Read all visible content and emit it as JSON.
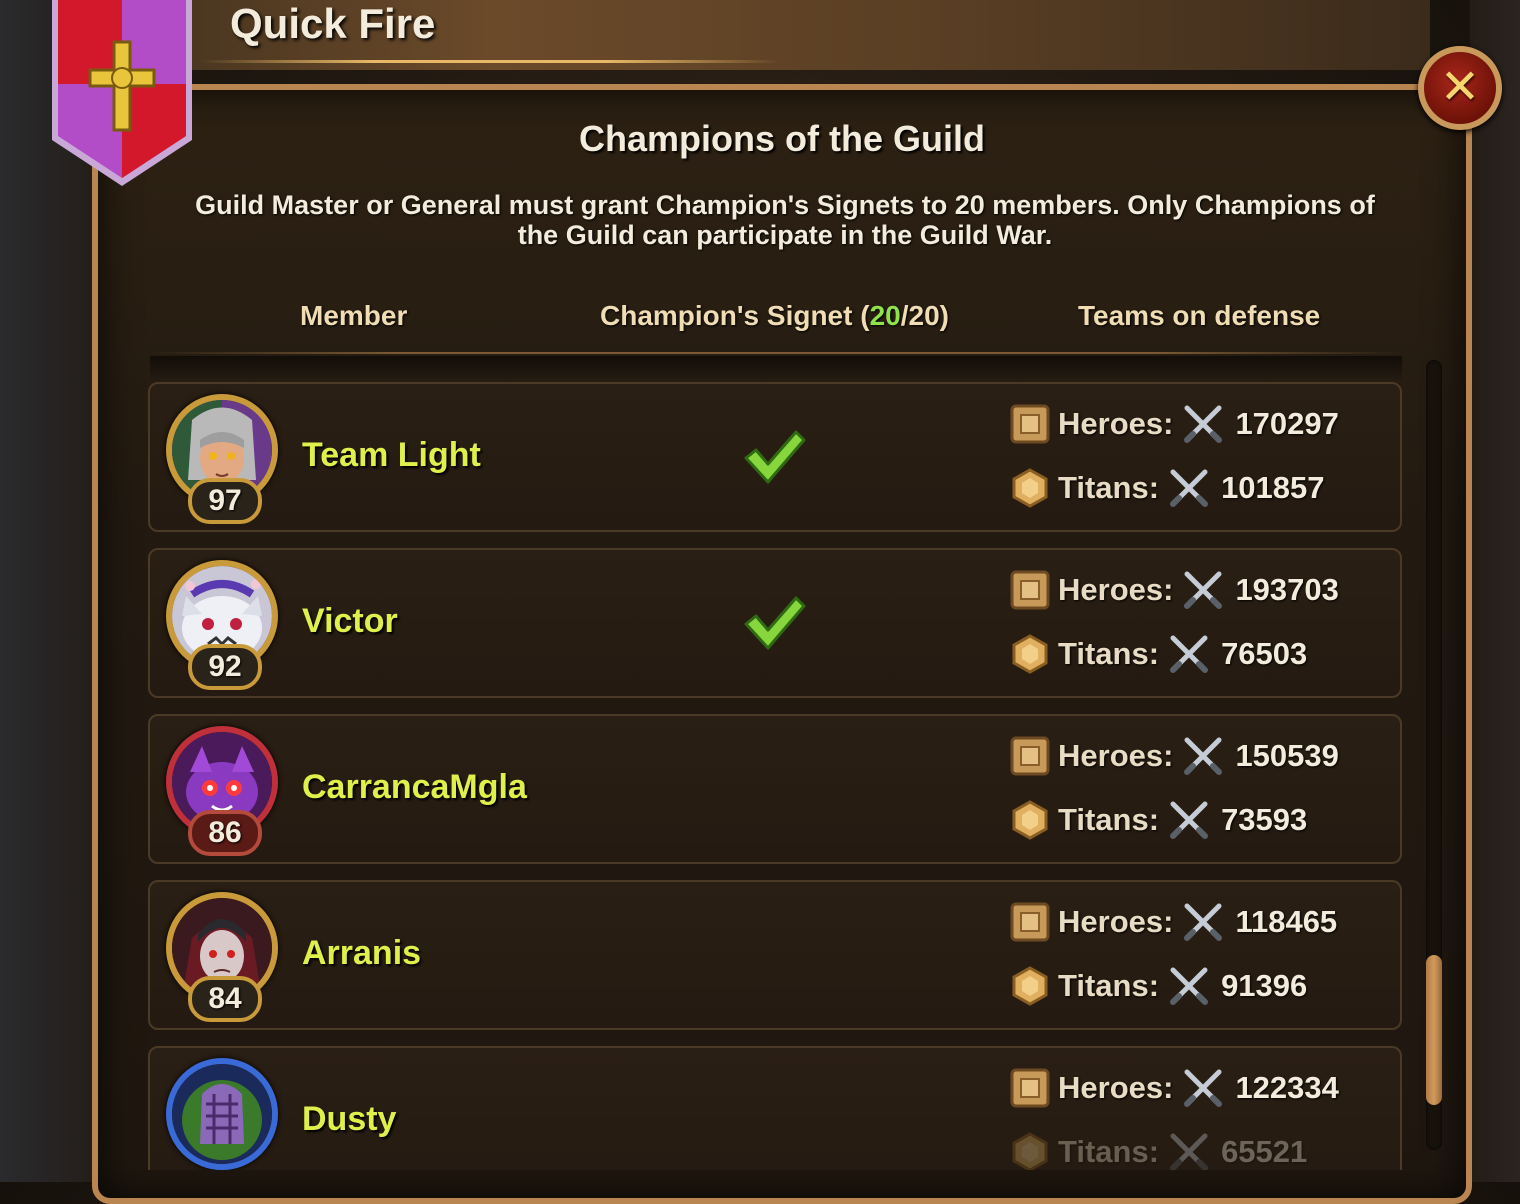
{
  "guild": {
    "name": "Quick Fire"
  },
  "dialog": {
    "title": "Champions of the Guild",
    "notice": "Guild Master or General must grant Champion's Signets to 20 members. Only Champions of the Guild can participate in the Guild War."
  },
  "columns": {
    "member": "Member",
    "signet_prefix": "Champion's Signet (",
    "signet_granted": "20",
    "signet_total": "/20)",
    "teams": "Teams on defense"
  },
  "labels": {
    "heroes": "Heroes:",
    "titans": "Titans:"
  },
  "members": [
    {
      "name": "Team Light",
      "level": "97",
      "champion": true,
      "heroes_power": "170297",
      "titans_power": "101857",
      "avatar_icon": "elf-hero-avatar-icon"
    },
    {
      "name": "Victor",
      "level": "92",
      "champion": true,
      "heroes_power": "193703",
      "titans_power": "76503",
      "avatar_icon": "white-cat-avatar-icon"
    },
    {
      "name": "CarrancaMgla",
      "level": "86",
      "champion": false,
      "heroes_power": "150539",
      "titans_power": "73593",
      "avatar_icon": "purple-creature-avatar-icon"
    },
    {
      "name": "Arranis",
      "level": "84",
      "champion": false,
      "heroes_power": "118465",
      "titans_power": "91396",
      "avatar_icon": "vampire-avatar-icon"
    },
    {
      "name": "Dusty",
      "level": "",
      "champion": false,
      "heroes_power": "122334",
      "titans_power": "65521",
      "avatar_icon": "helmet-avatar-icon"
    }
  ],
  "colors": {
    "member_name": "#dff04a",
    "check_green": "#8fe24a",
    "frame_gold": "#b98550",
    "close_red": "#a8261a"
  },
  "icons": {
    "close": "close-icon",
    "check": "checkmark-icon",
    "heroes": "hero-team-icon",
    "titans": "titan-team-icon",
    "power": "crossed-swords-icon",
    "banner": "guild-banner-icon"
  }
}
